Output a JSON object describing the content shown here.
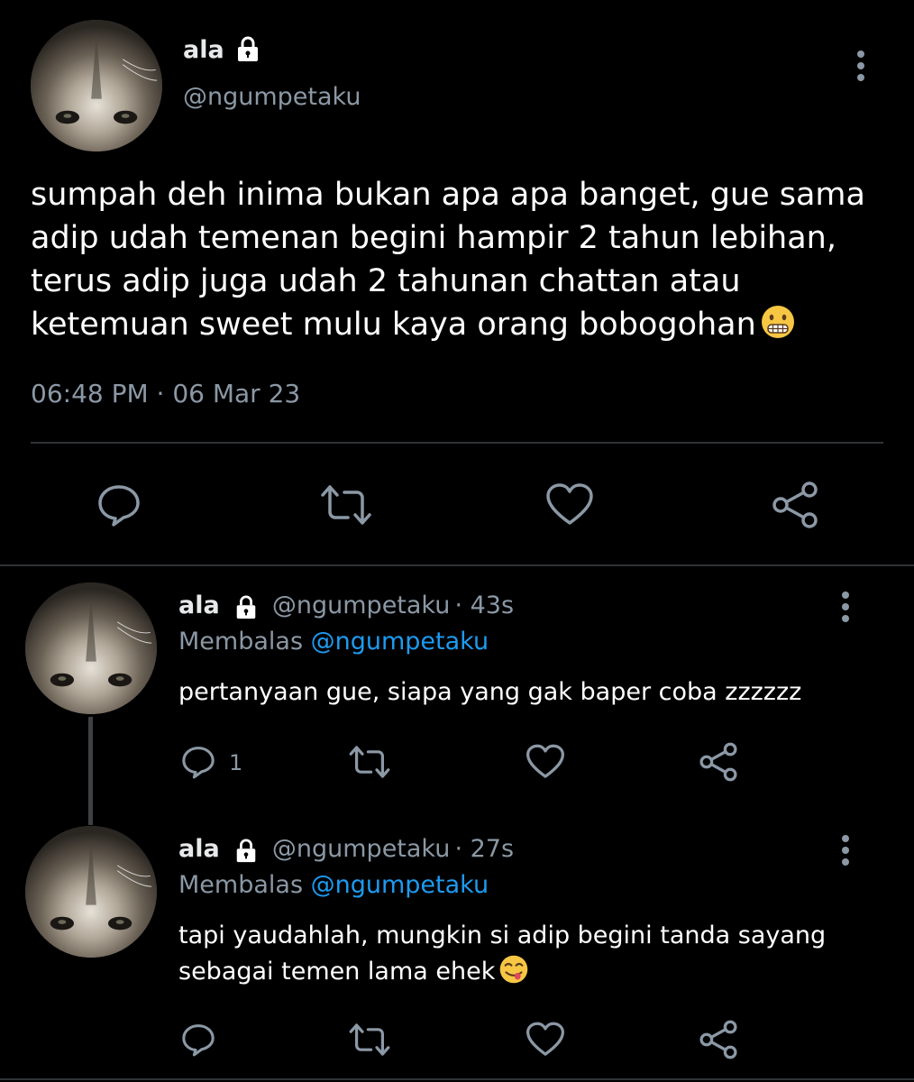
{
  "tweet": {
    "author_name": "ala",
    "author_handle": "@ngumpetaku",
    "avatar_icon": "cat-avatar",
    "text_lines": [
      "sumpah deh inima bukan apa apa banget, gue sama",
      "adip udah temenan begini hampir 2 tahun lebihan,",
      "terus adip juga udah 2 tahunan chattan atau",
      "ketemuan sweet mulu kaya orang bobogohan"
    ],
    "emoji_icon": "grimacing-face-emoji",
    "timestamp": "06:48 PM · 06 Mar 23",
    "actions": [
      "reply-icon",
      "retweet-icon",
      "like-icon",
      "share-icon"
    ]
  },
  "replies": [
    {
      "author_name": "ala",
      "author_handle": "@ngumpetaku",
      "time": "· 43s",
      "replying_label": "Membalas",
      "replying_to": "@ngumpetaku",
      "text_lines": [
        "pertanyaan gue, siapa yang gak baper coba zzzzzz"
      ],
      "reply_count": "1"
    },
    {
      "author_name": "ala",
      "author_handle": "@ngumpetaku",
      "time": "· 27s",
      "replying_label": "Membalas",
      "replying_to": "@ngumpetaku",
      "text_lines": [
        "tapi yaudahlah, mungkin si adip begini tanda sayang",
        "sebagai temen lama ehek"
      ],
      "emoji_icon": "face-savoring-food-emoji",
      "reply_count": ""
    }
  ],
  "colors": {
    "background": "#000000",
    "text": "#e7e9ea",
    "secondary": "#8b98a5",
    "link": "#1d9bf0",
    "divider": "#2f3336"
  }
}
